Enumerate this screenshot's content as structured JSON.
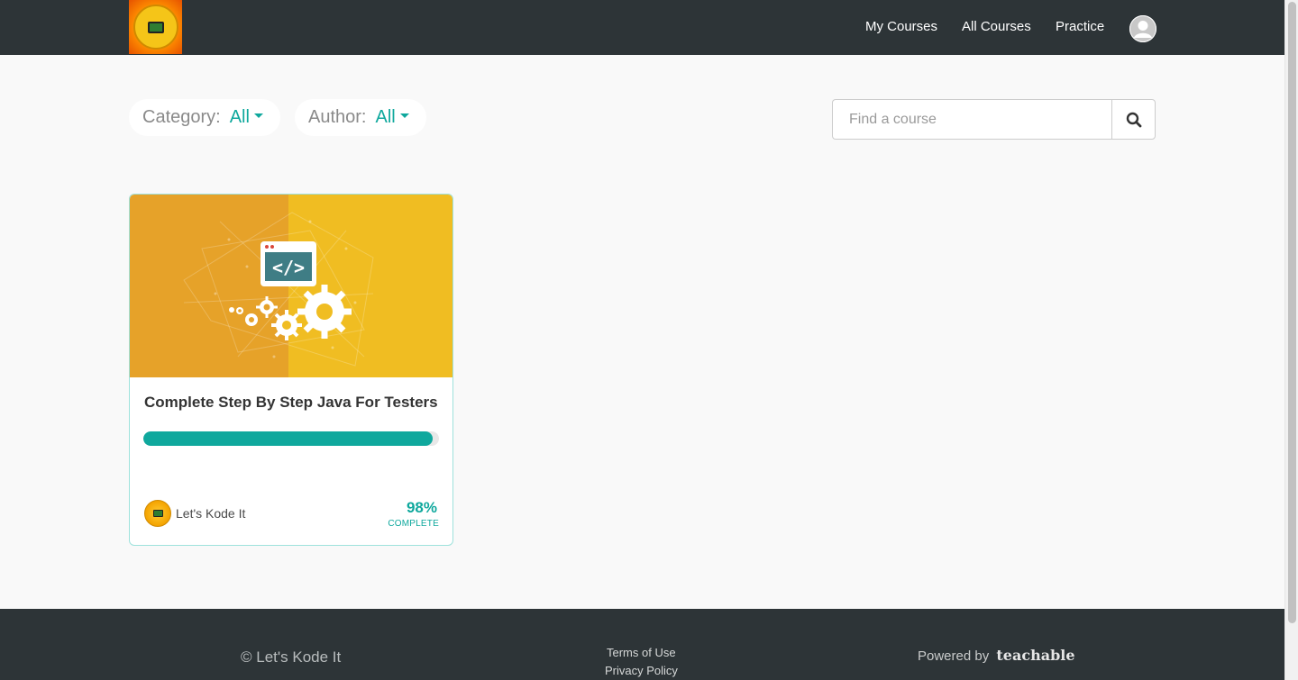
{
  "header": {
    "nav": [
      {
        "label": "My Courses"
      },
      {
        "label": "All Courses"
      },
      {
        "label": "Practice"
      }
    ]
  },
  "filters": {
    "category": {
      "label": "Category:",
      "value": "All"
    },
    "author": {
      "label": "Author:",
      "value": "All"
    }
  },
  "search": {
    "placeholder": "Find a course"
  },
  "course": {
    "title": "Complete Step By Step Java For Testers",
    "author": "Let's Kode It",
    "progress_percent": 98,
    "percent_label": "98%",
    "status_label": "COMPLETE"
  },
  "footer": {
    "copyright": "© Let's Kode It",
    "links": [
      "Terms of Use",
      "Privacy Policy"
    ],
    "powered_by": "Powered by",
    "brand": "teachable"
  },
  "colors": {
    "nav_bg": "#2d3437",
    "accent": "#0fa89d",
    "card_image_left": "#e6a229",
    "card_image_right": "#f0bd22"
  },
  "icons": [
    "search-icon",
    "user-avatar-icon",
    "code-window-icon",
    "gears-icon"
  ]
}
